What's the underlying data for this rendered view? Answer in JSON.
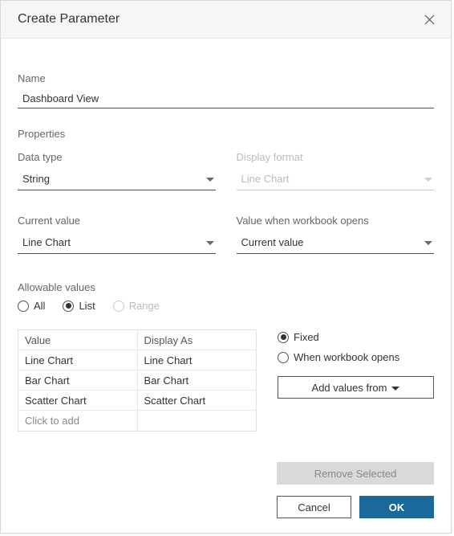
{
  "dialog": {
    "title": "Create Parameter"
  },
  "name": {
    "label": "Name",
    "value": "Dashboard View"
  },
  "properties": {
    "label": "Properties",
    "data_type": {
      "label": "Data type",
      "value": "String"
    },
    "display_format": {
      "label": "Display format",
      "value": "Line Chart"
    },
    "current_value": {
      "label": "Current value",
      "value": "Line Chart"
    },
    "value_when_open": {
      "label": "Value when workbook opens",
      "value": "Current value"
    }
  },
  "allowable": {
    "label": "Allowable values",
    "options": {
      "all": "All",
      "list": "List",
      "range": "Range"
    },
    "selected": "list"
  },
  "table": {
    "headers": {
      "value": "Value",
      "display_as": "Display As"
    },
    "rows": [
      {
        "value": "Line Chart",
        "display_as": "Line Chart"
      },
      {
        "value": "Bar Chart",
        "display_as": "Bar Chart"
      },
      {
        "value": "Scatter Chart",
        "display_as": "Scatter Chart"
      }
    ],
    "add_row": "Click to add"
  },
  "list_opts": {
    "fixed": "Fixed",
    "when_open": "When workbook opens",
    "selected": "fixed",
    "add_values": "Add values from"
  },
  "footer": {
    "remove": "Remove Selected",
    "cancel": "Cancel",
    "ok": "OK"
  }
}
